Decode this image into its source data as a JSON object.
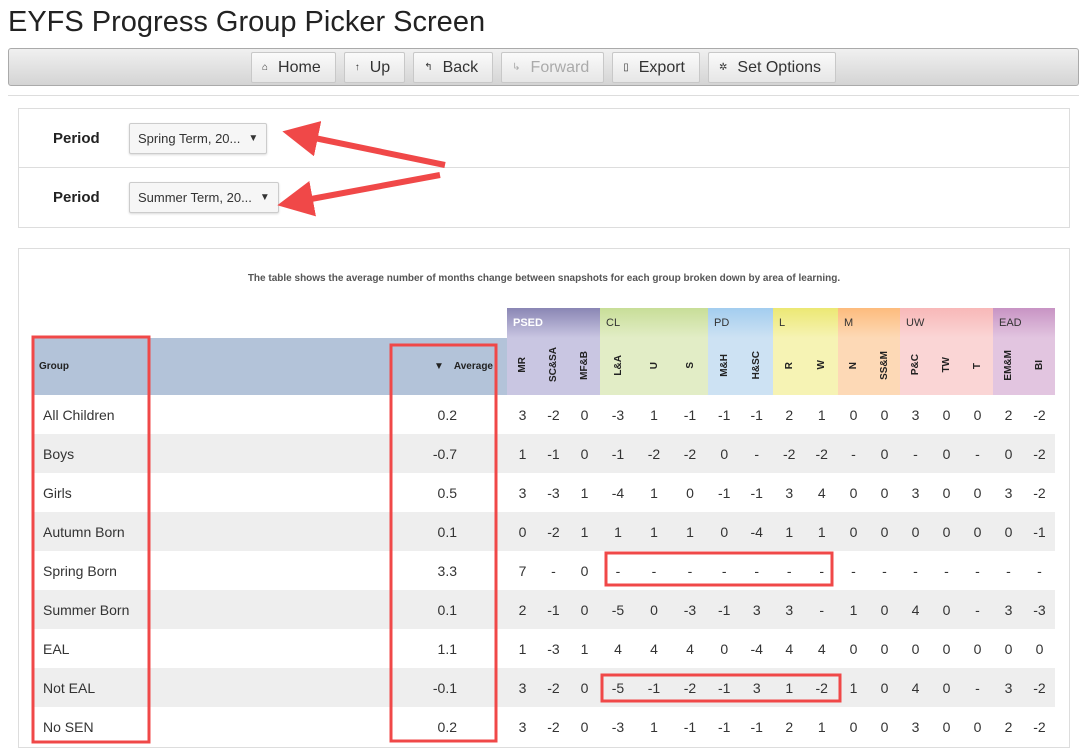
{
  "title": "EYFS Progress Group Picker Screen",
  "toolbar": {
    "home": "Home",
    "up": "Up",
    "back": "Back",
    "forward": "Forward",
    "export": "Export",
    "set_options": "Set Options"
  },
  "periods": [
    {
      "label": "Period",
      "value": "Spring Term, 20..."
    },
    {
      "label": "Period",
      "value": "Summer Term, 20..."
    }
  ],
  "description": "The table shows the average number of months change between snapshots for each group broken down by area of learning.",
  "table": {
    "group_header": "Group",
    "average_header": "Average",
    "areas": [
      {
        "name": "PSED",
        "color": "#c9c6e2",
        "head": "#8a86b4",
        "subs": [
          "MR",
          "SC&SA",
          "MF&B"
        ]
      },
      {
        "name": "CL",
        "color": "#e2edc6",
        "head": "#c8de98",
        "subs": [
          "L&A",
          "U",
          "S"
        ]
      },
      {
        "name": "PD",
        "color": "#cde2f3",
        "head": "#a3cdef",
        "subs": [
          "M&H",
          "H&SC"
        ]
      },
      {
        "name": "L",
        "color": "#f6f3b4",
        "head": "#ece874",
        "subs": [
          "R",
          "W"
        ]
      },
      {
        "name": "M",
        "color": "#fdd9b6",
        "head": "#fdbb7d",
        "subs": [
          "N",
          "SS&M"
        ]
      },
      {
        "name": "UW",
        "color": "#fad5d5",
        "head": "#f8b8b8",
        "subs": [
          "P&C",
          "TW",
          "T"
        ]
      },
      {
        "name": "EAD",
        "color": "#e2c5e0",
        "head": "#c894c4",
        "subs": [
          "EM&M",
          "BI"
        ]
      }
    ],
    "rows": [
      {
        "group": "All Children",
        "average": "0.2",
        "values": [
          "3",
          "-2",
          "0",
          "-3",
          "1",
          "-1",
          "-1",
          "-1",
          "2",
          "1",
          "0",
          "0",
          "3",
          "0",
          "0",
          "2",
          "-2"
        ]
      },
      {
        "group": "Boys",
        "average": "-0.7",
        "values": [
          "1",
          "-1",
          "0",
          "-1",
          "-2",
          "-2",
          "0",
          "-",
          "-2",
          "-2",
          "-",
          "0",
          "-",
          "0",
          "-",
          "0",
          "-2"
        ]
      },
      {
        "group": "Girls",
        "average": "0.5",
        "values": [
          "3",
          "-3",
          "1",
          "-4",
          "1",
          "0",
          "-1",
          "-1",
          "3",
          "4",
          "0",
          "0",
          "3",
          "0",
          "0",
          "3",
          "-2"
        ]
      },
      {
        "group": "Autumn Born",
        "average": "0.1",
        "values": [
          "0",
          "-2",
          "1",
          "1",
          "1",
          "1",
          "0",
          "-4",
          "1",
          "1",
          "0",
          "0",
          "0",
          "0",
          "0",
          "0",
          "-1"
        ]
      },
      {
        "group": "Spring Born",
        "average": "3.3",
        "values": [
          "7",
          "-",
          "0",
          "-",
          "-",
          "-",
          "-",
          "-",
          "-",
          "-",
          "-",
          "-",
          "-",
          "-",
          "-",
          "-",
          "-"
        ]
      },
      {
        "group": "Summer Born",
        "average": "0.1",
        "values": [
          "2",
          "-1",
          "0",
          "-5",
          "0",
          "-3",
          "-1",
          "3",
          "3",
          "-",
          "1",
          "0",
          "4",
          "0",
          "-",
          "3",
          "-3"
        ]
      },
      {
        "group": "EAL",
        "average": "1.1",
        "values": [
          "1",
          "-3",
          "1",
          "4",
          "4",
          "4",
          "0",
          "-4",
          "4",
          "4",
          "0",
          "0",
          "0",
          "0",
          "0",
          "0",
          "0"
        ]
      },
      {
        "group": "Not EAL",
        "average": "-0.1",
        "values": [
          "3",
          "-2",
          "0",
          "-5",
          "-1",
          "-2",
          "-1",
          "3",
          "1",
          "-2",
          "1",
          "0",
          "4",
          "0",
          "-",
          "3",
          "-2"
        ]
      },
      {
        "group": "No SEN",
        "average": "0.2",
        "values": [
          "3",
          "-2",
          "0",
          "-3",
          "1",
          "-1",
          "-1",
          "-1",
          "2",
          "1",
          "0",
          "0",
          "3",
          "0",
          "0",
          "2",
          "-2"
        ]
      }
    ]
  },
  "annotation_color": "#f04848"
}
